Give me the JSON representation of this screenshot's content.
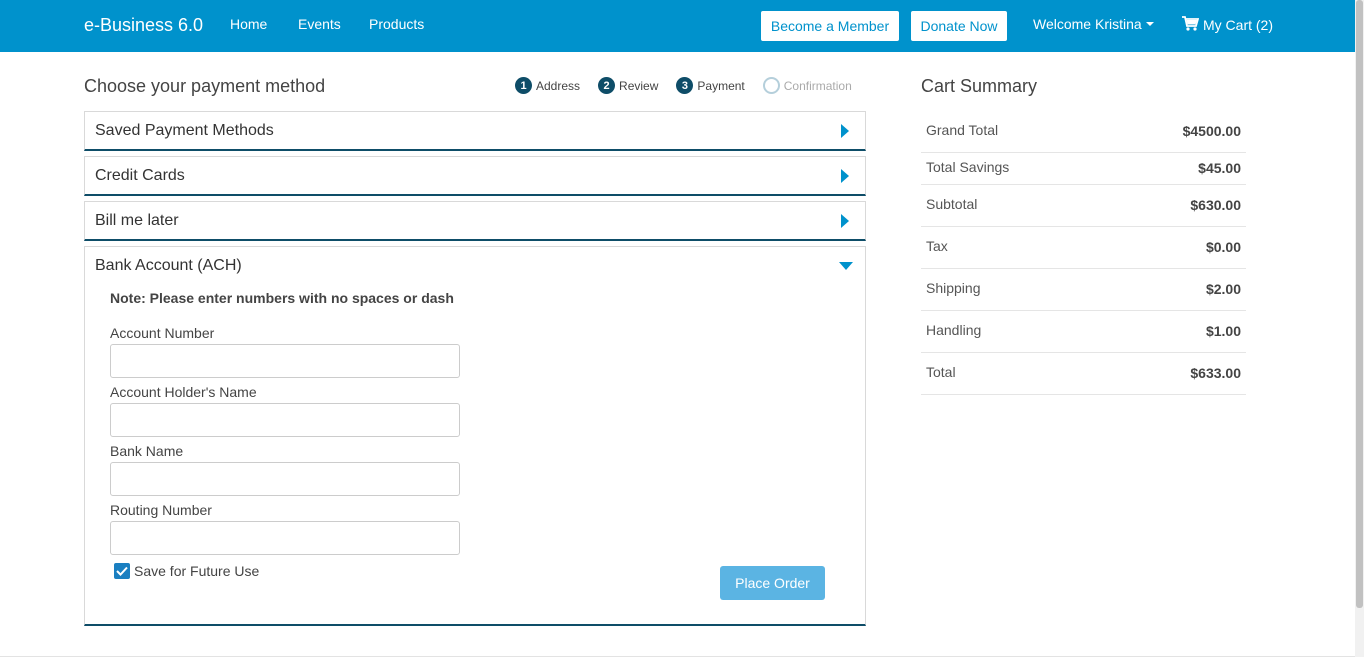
{
  "navbar": {
    "brand": "e-Business 6.0",
    "links": [
      "Home",
      "Events",
      "Products"
    ],
    "become_member": "Become a Member",
    "donate_now": "Donate Now",
    "welcome": "Welcome Kristina",
    "cart": "My Cart (2)"
  },
  "payment": {
    "title": "Choose your payment method",
    "steps": [
      {
        "num": "1",
        "label": "Address"
      },
      {
        "num": "2",
        "label": "Review"
      },
      {
        "num": "3",
        "label": "Payment"
      },
      {
        "num": "",
        "label": "Confirmation"
      }
    ],
    "panels": {
      "saved": "Saved Payment Methods",
      "credit": "Credit Cards",
      "bill": "Bill me later",
      "bank": "Bank Account (ACH)"
    },
    "ach": {
      "note": "Note: Please enter numbers with no spaces or dash",
      "account_number_label": "Account Number",
      "account_holder_label": "Account Holder's Name",
      "bank_name_label": "Bank Name",
      "routing_number_label": "Routing Number",
      "account_number_value": "",
      "account_holder_value": "",
      "bank_name_value": "",
      "routing_number_value": "",
      "save_label": "Save for Future Use",
      "save_checked": true,
      "place_order": "Place Order"
    }
  },
  "cart_summary": {
    "title": "Cart Summary",
    "rows": [
      {
        "label": "Grand Total",
        "value": "$4500.00"
      },
      {
        "label": "Total Savings",
        "value": "$45.00"
      },
      {
        "label": "Subtotal",
        "value": "$630.00"
      },
      {
        "label": "Tax",
        "value": "$0.00"
      },
      {
        "label": "Shipping",
        "value": "$2.00"
      },
      {
        "label": "Handling",
        "value": "$1.00"
      },
      {
        "label": "Total",
        "value": "$633.00"
      }
    ]
  },
  "colors": {
    "navbar": "#0092cc",
    "accent_dark": "#0e4d68",
    "button_light": "#5bb4e3"
  }
}
